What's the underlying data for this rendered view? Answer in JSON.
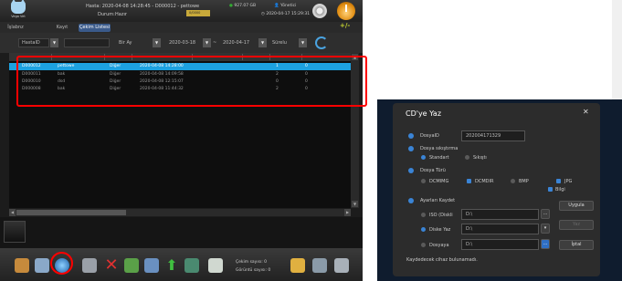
{
  "app": {
    "logo_text": "Vega Vet",
    "hasta_label": "Hasta: 2020-04-08 14:28:45 - D000012 - pettowe",
    "durum_label": "Durum:",
    "durum_value": "Hazır",
    "badge": "0/0000",
    "disk": "927.07 GB",
    "user": "Yönetici",
    "clock": "2020-04-17 15:29:31",
    "tabs": [
      {
        "label": "İşlabnz"
      },
      {
        "label": "Kayıt"
      },
      {
        "label": "Çekim Listesi"
      }
    ],
    "plusminus": "+/-",
    "filter": {
      "field": "HastaID",
      "mode": "Bir Ay",
      "date_from": "2020-03-18",
      "date_sep": "~",
      "date_to": "2020-04-17",
      "extra": "Sürelu"
    },
    "rows": [
      {
        "id": "D000012",
        "name": "pettowe",
        "type": "Diğer",
        "date": "2020-04-08 14:28:00",
        "c1": "1",
        "c2": "0"
      },
      {
        "id": "D000011",
        "name": "bak",
        "type": "Diğer",
        "date": "2020-04-08 14:09:58",
        "c1": "2",
        "c2": "0"
      },
      {
        "id": "D000010",
        "name": "dsd",
        "type": "Diğer",
        "date": "2020-04-08 12:15:07",
        "c1": "0",
        "c2": "0"
      },
      {
        "id": "D000008",
        "name": "bak",
        "type": "Diğer",
        "date": "2020-04-08 11:44:32",
        "c1": "2",
        "c2": "0"
      }
    ],
    "counts": {
      "cekim": "Çekim sayısı: 0",
      "goruntu": "Görüntü sayısı: 0"
    }
  },
  "dialog": {
    "title": "CD'ye Yaz",
    "close": "✕",
    "dosya_id_label": "DosyaID",
    "dosya_id_value": "202004171329",
    "sikistirma_label": "Dosya sıkıştırma",
    "standart": "Standart",
    "sikisti": "Sıkıştı",
    "turu_label": "Dosya Türü",
    "dcmimg": "DCMIMG",
    "dcmdir": "DCMDIR",
    "bmp": "BMP",
    "jpg": "JPG",
    "bilgi": "Bilgi",
    "ayarlari_label": "Ayarları Kaydet",
    "uygula": "Uygula",
    "iso_label": "ISO (Diskli",
    "iso_value": "D:\\",
    "diske_label": "Diske Yaz",
    "diske_value": "D:\\",
    "dosyaya_label": "Dosyaya",
    "dosyaya_value": "D:\\",
    "yaz_btn": "Yaz",
    "iptal_btn": "İptal",
    "browse": "...",
    "status": "Kaydedecek cihaz bulunamadı."
  },
  "colors": {
    "accent": "#1da1e0",
    "highlight": "#ff0000",
    "dialog_bg": "#2c2c2c"
  }
}
